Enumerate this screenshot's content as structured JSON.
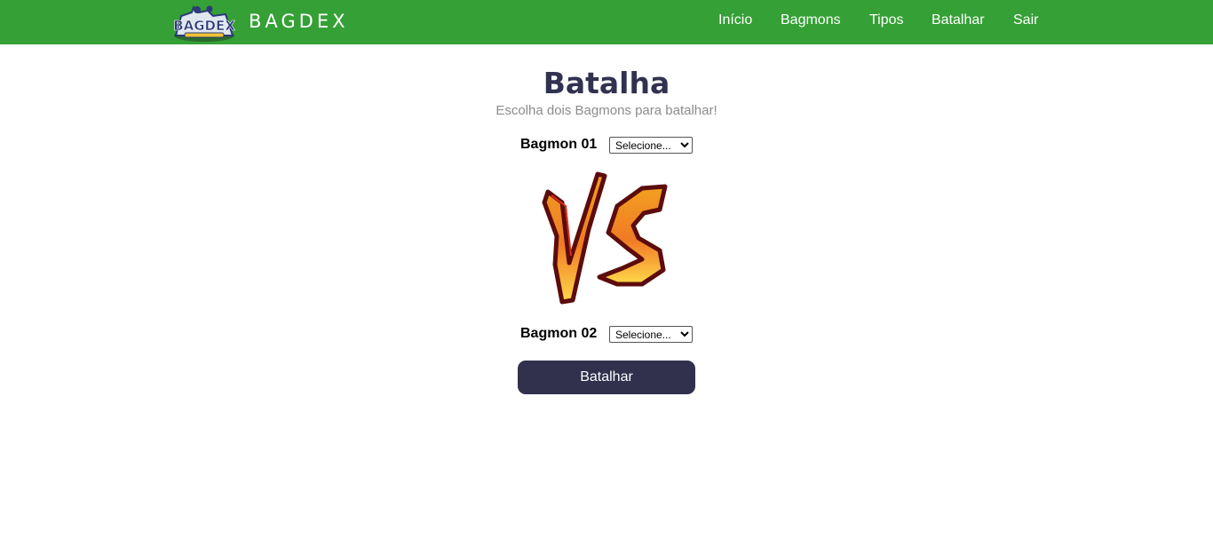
{
  "header": {
    "brand": "BAGDEX",
    "nav": [
      "Início",
      "Bagmons",
      "Tipos",
      "Batalhar",
      "Sair"
    ]
  },
  "page": {
    "title": "Batalha",
    "subtitle": "Escolha dois Bagmons para batalhar!"
  },
  "form": {
    "bagmon1_label": "Bagmon 01",
    "bagmon2_label": "Bagmon 02",
    "select_placeholder": "Selecione...",
    "submit_label": "Batalhar"
  },
  "colors": {
    "navbar": "#35a035",
    "title": "#313150",
    "button": "#31304d"
  }
}
